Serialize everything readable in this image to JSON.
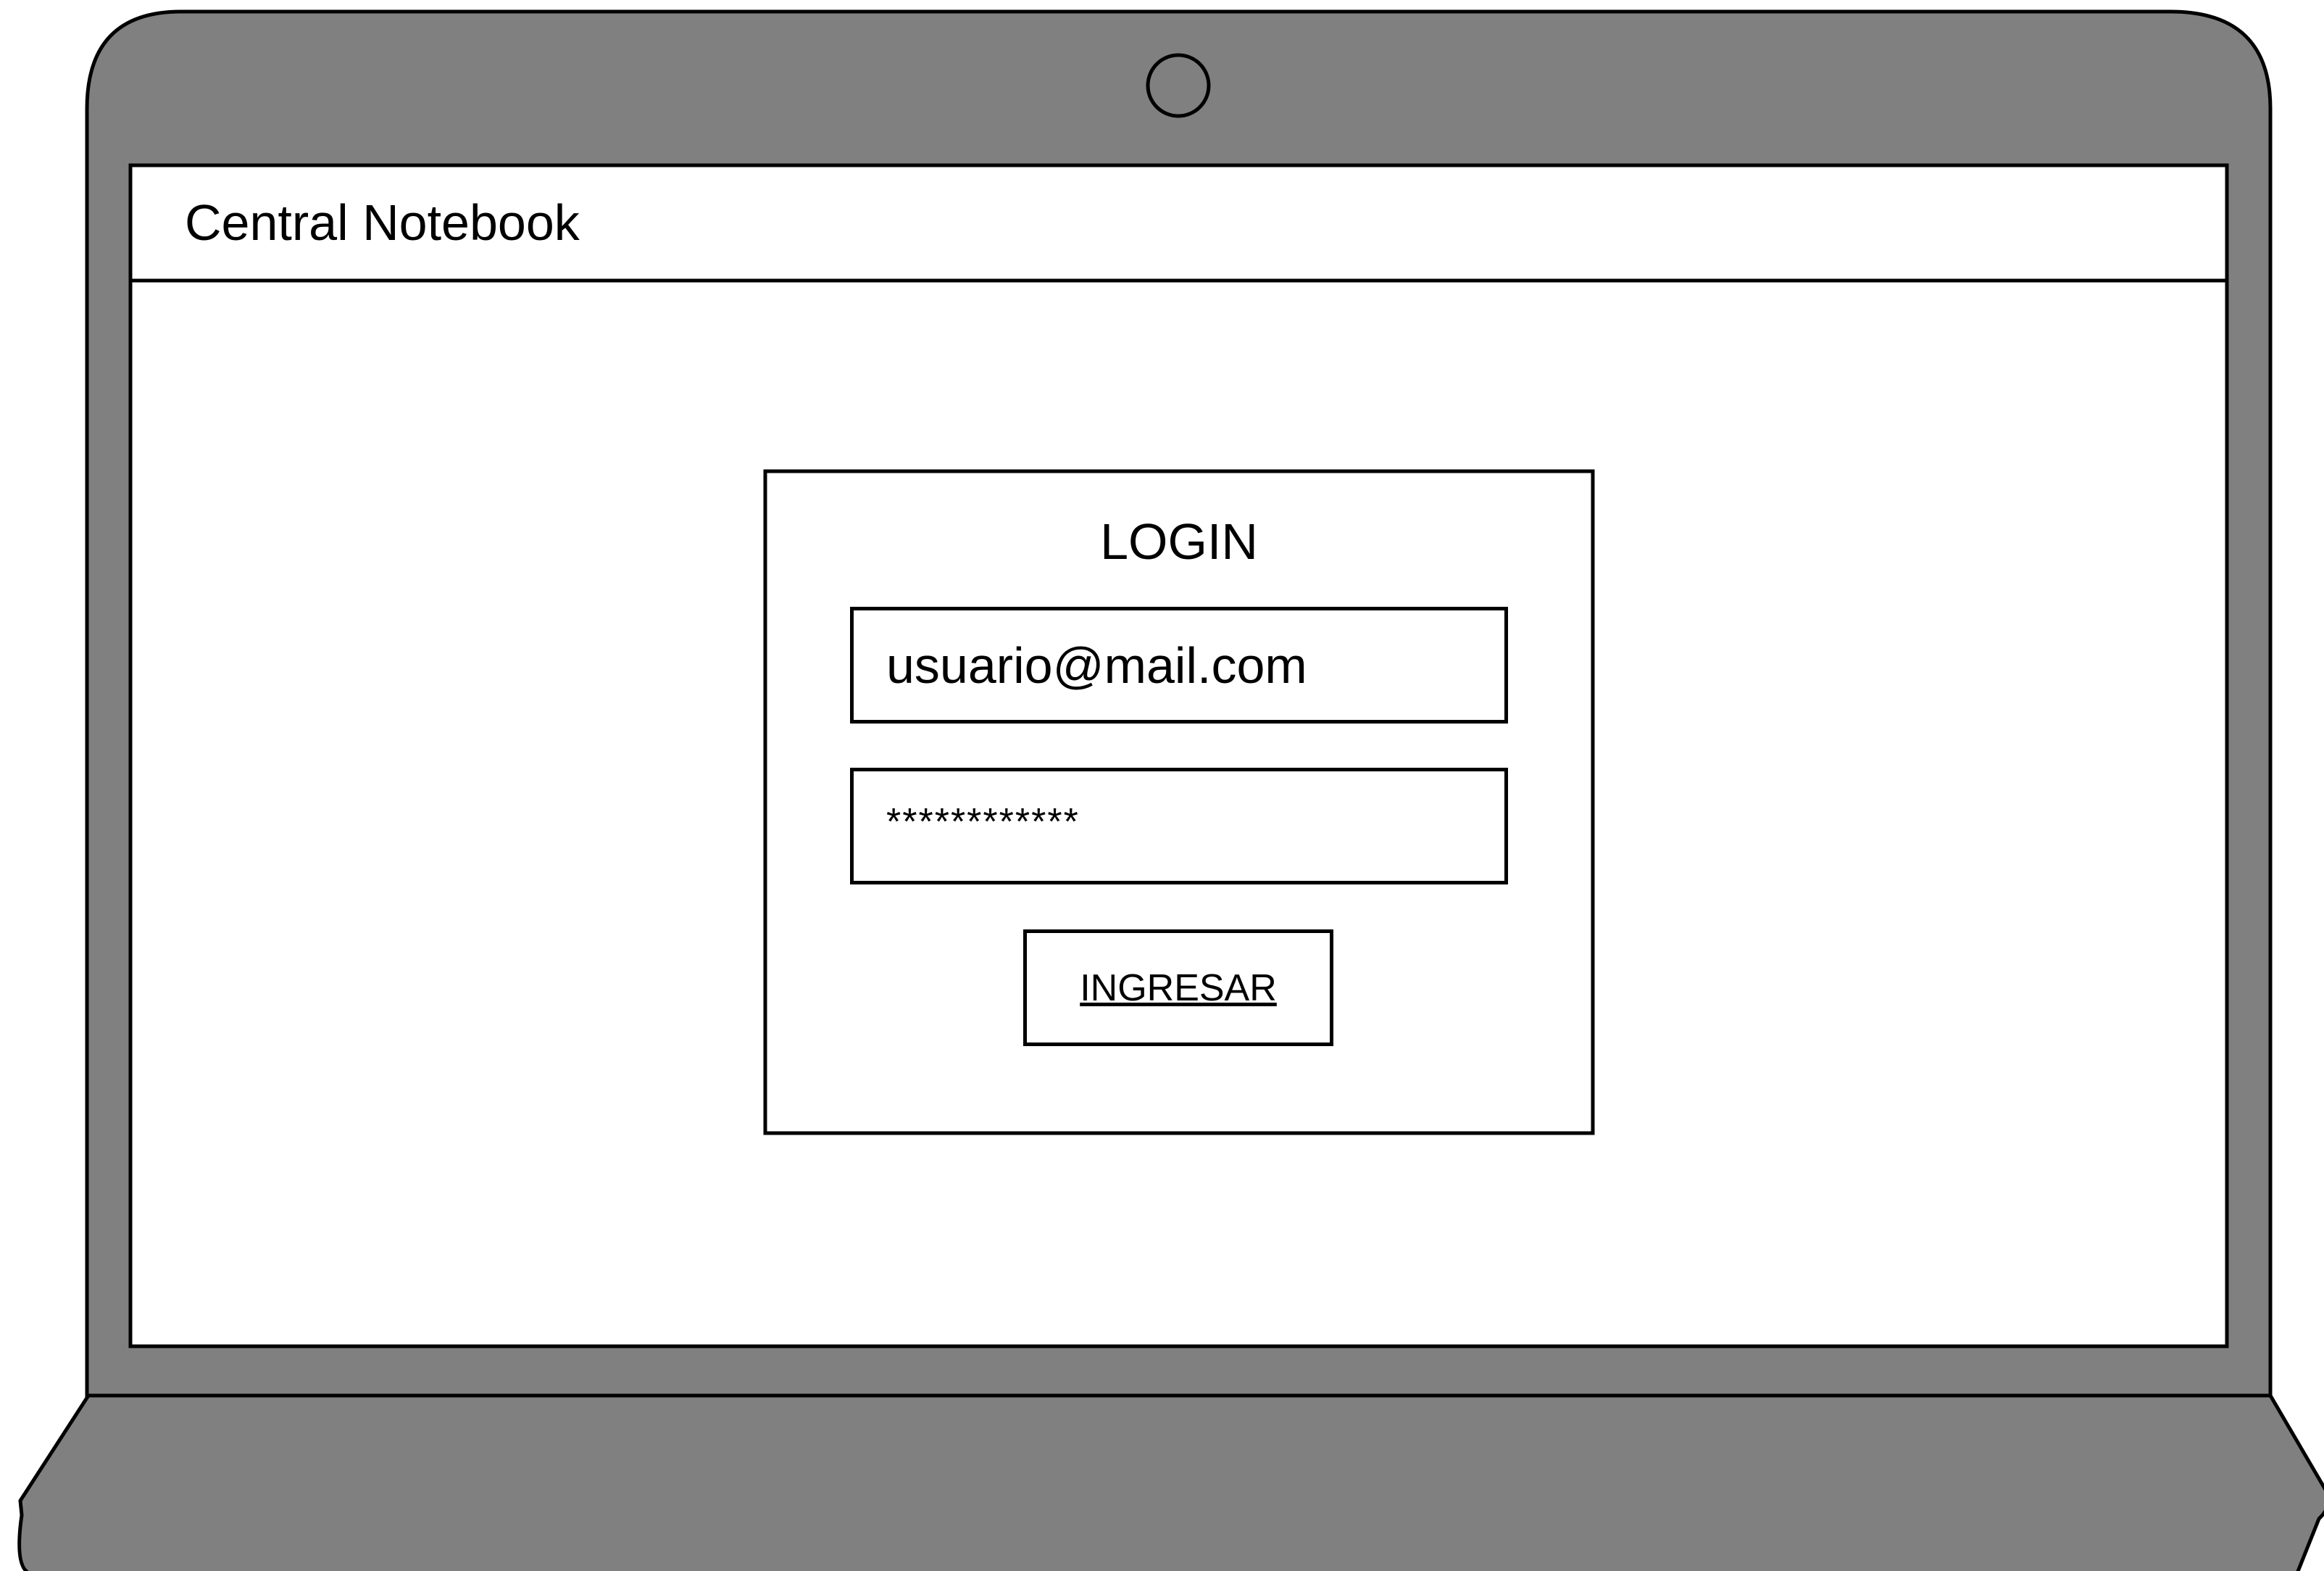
{
  "app": {
    "title": "Central Notebook"
  },
  "login": {
    "heading": "LOGIN",
    "email_value": "usuario@mail.com",
    "password_value": "************",
    "submit_label": "INGRESAR"
  },
  "colors": {
    "laptop_body": "#808080",
    "screen_bg": "#ffffff",
    "outline": "#000000"
  },
  "icons": {
    "webcam": "webcam-icon"
  }
}
